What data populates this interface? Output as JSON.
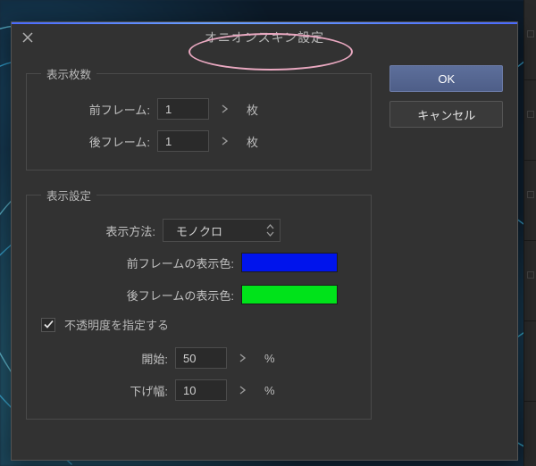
{
  "dialog": {
    "title": "オニオンスキン設定"
  },
  "frameCount": {
    "legend": "表示枚数",
    "prev_label": "前フレーム:",
    "prev_value": "1",
    "next_label": "後フレーム:",
    "next_value": "1",
    "unit": "枚"
  },
  "displaySettings": {
    "legend": "表示設定",
    "method_label": "表示方法:",
    "method_value": "モノクロ",
    "prev_color_label": "前フレームの表示色:",
    "prev_color_value": "#0014ec",
    "next_color_label": "後フレームの表示色:",
    "next_color_value": "#00e31a",
    "opacity_check_label": "不透明度を指定する",
    "opacity_checked": true,
    "start_label": "開始:",
    "start_value": "50",
    "step_label": "下げ幅:",
    "step_value": "10",
    "percent": "%"
  },
  "buttons": {
    "ok": "OK",
    "cancel": "キャンセル"
  }
}
